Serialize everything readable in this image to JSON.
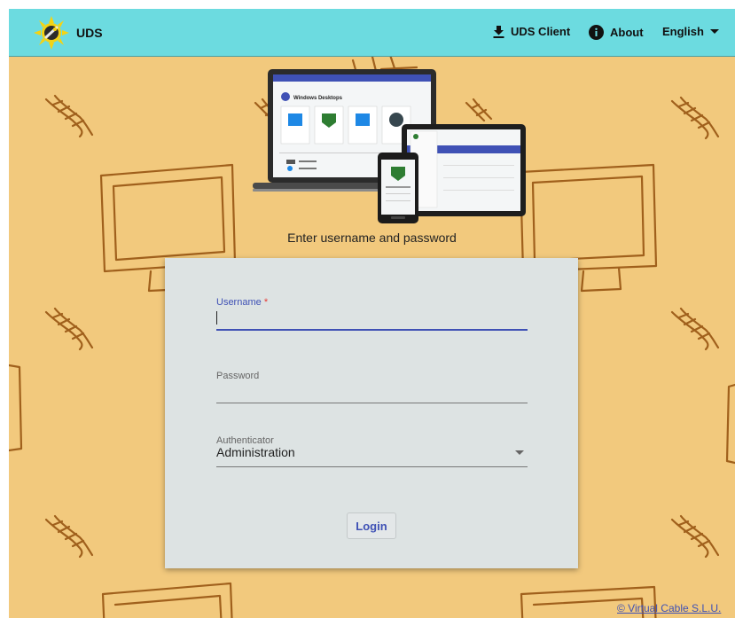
{
  "header": {
    "brand": "UDS",
    "logo_icon": "uds-sun-logo-icon",
    "nav": {
      "client_label": "UDS Client",
      "client_icon": "download-icon",
      "about_label": "About",
      "about_icon": "info-icon",
      "language_label": "English",
      "language_icon": "caret-down-icon"
    }
  },
  "hero": {
    "panel_title": "Windows Desktops",
    "services": [
      "Escritorio Windows",
      "Aplicaciones",
      "Win 10",
      "Win11"
    ]
  },
  "login": {
    "subtitle": "Enter username and password",
    "username_label": "Username",
    "username_required": "*",
    "username_value": "",
    "password_label": "Password",
    "password_value": "",
    "authenticator_label": "Authenticator",
    "authenticator_value": "Administration",
    "submit_label": "Login"
  },
  "footer": {
    "copyright": "© Virtual Cable S.L.U."
  },
  "colors": {
    "header_bg": "#6cdbe0",
    "page_bg": "#f2c97d",
    "card_bg": "#dde3e3",
    "accent": "#3f51b5",
    "doodle": "#a0601c"
  }
}
